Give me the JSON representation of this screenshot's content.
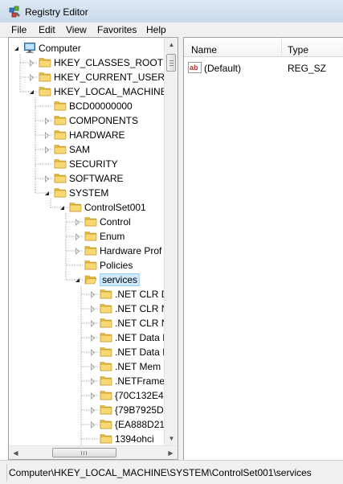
{
  "window": {
    "title": "Registry Editor"
  },
  "menu": {
    "file": "File",
    "edit": "Edit",
    "view": "View",
    "favorites": "Favorites",
    "help": "Help"
  },
  "tree": {
    "nodes": [
      {
        "label": "Computer",
        "icon": "computer-icon",
        "expander": "expanded"
      },
      {
        "label": "HKEY_CLASSES_ROOT",
        "icon": "folder-icon",
        "expander": "collapsed"
      },
      {
        "label": "HKEY_CURRENT_USER",
        "icon": "folder-icon",
        "expander": "collapsed"
      },
      {
        "label": "HKEY_LOCAL_MACHINE",
        "icon": "folder-icon",
        "expander": "expanded"
      },
      {
        "label": "BCD00000000",
        "icon": "folder-icon",
        "expander": "none"
      },
      {
        "label": "COMPONENTS",
        "icon": "folder-icon",
        "expander": "collapsed"
      },
      {
        "label": "HARDWARE",
        "icon": "folder-icon",
        "expander": "collapsed"
      },
      {
        "label": "SAM",
        "icon": "folder-icon",
        "expander": "collapsed"
      },
      {
        "label": "SECURITY",
        "icon": "folder-icon",
        "expander": "none"
      },
      {
        "label": "SOFTWARE",
        "icon": "folder-icon",
        "expander": "collapsed"
      },
      {
        "label": "SYSTEM",
        "icon": "folder-icon",
        "expander": "expanded"
      },
      {
        "label": "ControlSet001",
        "icon": "folder-icon",
        "expander": "expanded"
      },
      {
        "label": "Control",
        "icon": "folder-icon",
        "expander": "collapsed"
      },
      {
        "label": "Enum",
        "icon": "folder-icon",
        "expander": "collapsed"
      },
      {
        "label": "Hardware Prof",
        "icon": "folder-icon",
        "expander": "collapsed"
      },
      {
        "label": "Policies",
        "icon": "folder-icon",
        "expander": "none"
      },
      {
        "label": "services",
        "icon": "folder-open-icon",
        "expander": "expanded",
        "selected": true
      },
      {
        "label": ".NET CLR D",
        "icon": "folder-icon",
        "expander": "collapsed"
      },
      {
        "label": ".NET CLR N",
        "icon": "folder-icon",
        "expander": "collapsed"
      },
      {
        "label": ".NET CLR N",
        "icon": "folder-icon",
        "expander": "collapsed"
      },
      {
        "label": ".NET Data I",
        "icon": "folder-icon",
        "expander": "collapsed"
      },
      {
        "label": ".NET Data I",
        "icon": "folder-icon",
        "expander": "collapsed"
      },
      {
        "label": ".NET Mem",
        "icon": "folder-icon",
        "expander": "collapsed"
      },
      {
        "label": ".NETFrame",
        "icon": "folder-icon",
        "expander": "collapsed"
      },
      {
        "label": "{70C132E4-",
        "icon": "folder-icon",
        "expander": "collapsed"
      },
      {
        "label": "{79B7925D-",
        "icon": "folder-icon",
        "expander": "collapsed"
      },
      {
        "label": "{EA888D21",
        "icon": "folder-icon",
        "expander": "collapsed"
      },
      {
        "label": "1394ohci",
        "icon": "folder-icon",
        "expander": "none"
      }
    ]
  },
  "list": {
    "columns": {
      "name": "Name",
      "type": "Type"
    },
    "rows": [
      {
        "name": "(Default)",
        "type": "REG_SZ",
        "icon": "string-value-icon"
      }
    ]
  },
  "statusbar": {
    "path": "Computer\\HKEY_LOCAL_MACHINE\\SYSTEM\\ControlSet001\\services"
  },
  "colors": {
    "selection": "#cde8ff",
    "selection_border": "#99d1ff",
    "folder": "#f3cd5f"
  }
}
